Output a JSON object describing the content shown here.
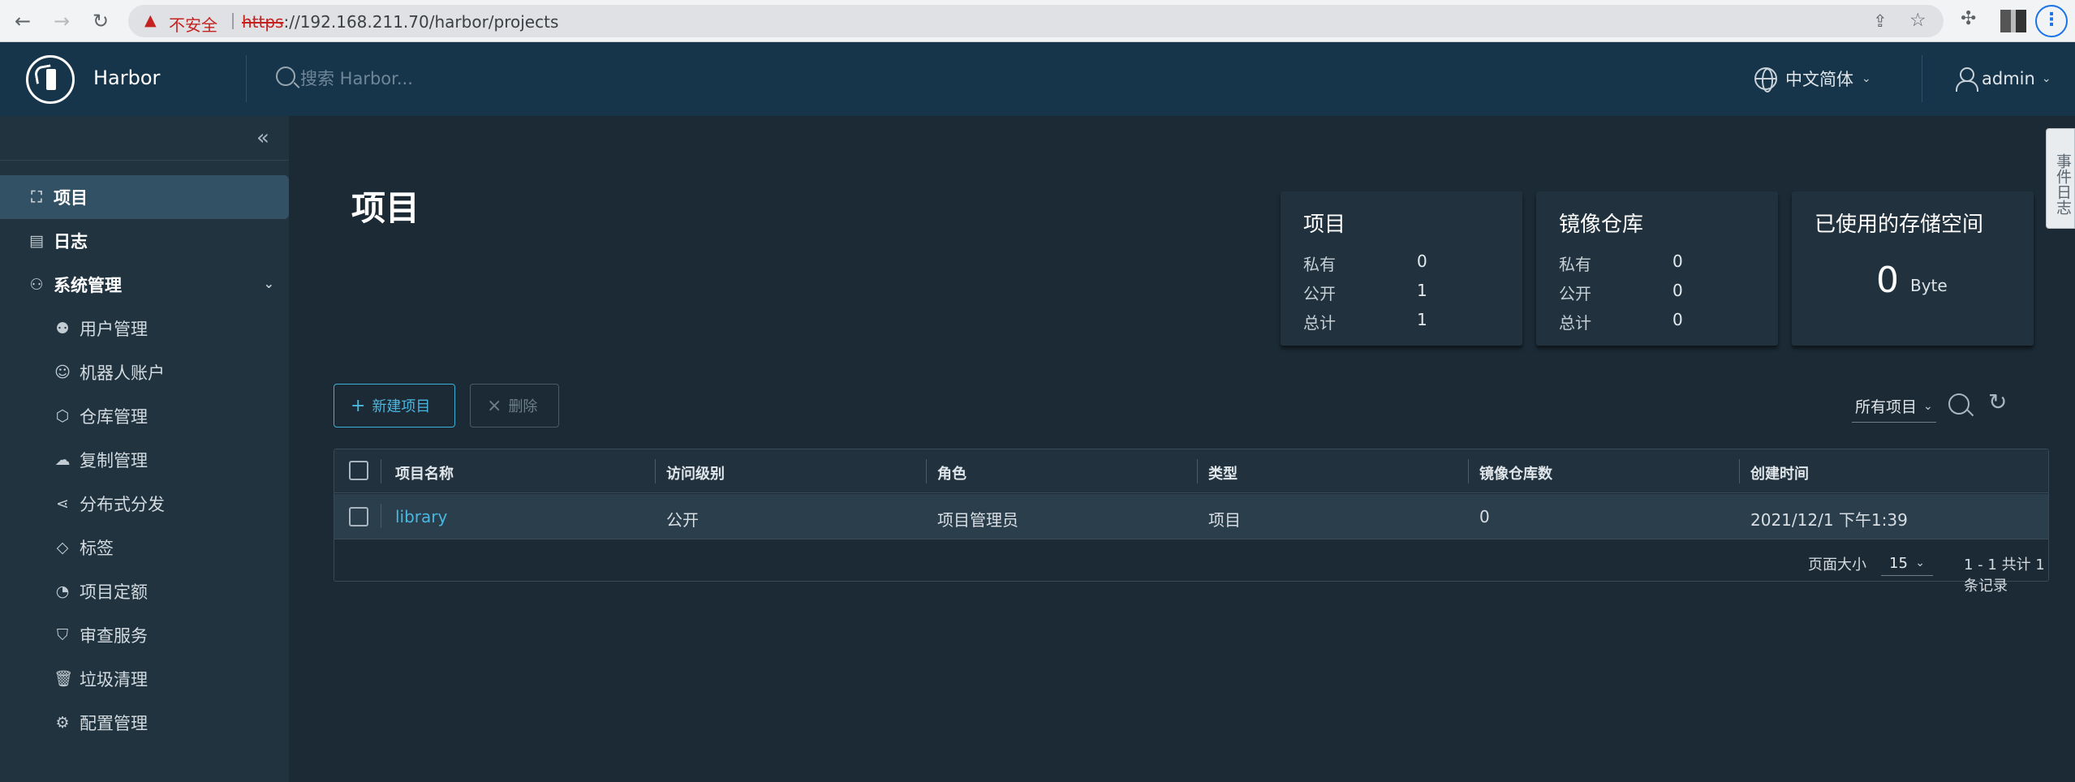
{
  "browser": {
    "security_label": "不安全",
    "url_scheme": "https",
    "url_rest": "://192.168.211.70/harbor/projects"
  },
  "header": {
    "brand": "Harbor",
    "search_placeholder": "搜索 Harbor...",
    "language": "中文简体",
    "user": "admin"
  },
  "sidebar": {
    "items": [
      {
        "label": "项目",
        "icon": "projects-icon",
        "active": true
      },
      {
        "label": "日志",
        "icon": "logs-icon"
      },
      {
        "label": "系统管理",
        "icon": "admin-icon",
        "expanded": true
      }
    ],
    "sub_items": [
      {
        "label": "用户管理",
        "icon": "users-icon"
      },
      {
        "label": "机器人账户",
        "icon": "robot-icon"
      },
      {
        "label": "仓库管理",
        "icon": "registry-icon"
      },
      {
        "label": "复制管理",
        "icon": "replication-icon"
      },
      {
        "label": "分布式分发",
        "icon": "distribution-icon"
      },
      {
        "label": "标签",
        "icon": "tag-icon"
      },
      {
        "label": "项目定额",
        "icon": "quota-icon"
      },
      {
        "label": "审查服务",
        "icon": "shield-icon"
      },
      {
        "label": "垃圾清理",
        "icon": "trash-icon"
      },
      {
        "label": "配置管理",
        "icon": "gear-icon"
      }
    ]
  },
  "main": {
    "title": "项目",
    "cards": {
      "projects": {
        "title": "项目",
        "rows": [
          {
            "label": "私有",
            "value": "0"
          },
          {
            "label": "公开",
            "value": "1"
          },
          {
            "label": "总计",
            "value": "1"
          }
        ]
      },
      "repos": {
        "title": "镜像仓库",
        "rows": [
          {
            "label": "私有",
            "value": "0"
          },
          {
            "label": "公开",
            "value": "0"
          },
          {
            "label": "总计",
            "value": "0"
          }
        ]
      },
      "storage": {
        "title": "已使用的存储空间",
        "value": "0",
        "unit": "Byte"
      }
    },
    "toolbar": {
      "new_project": "新建项目",
      "delete": "删除",
      "filter": "所有项目"
    },
    "table": {
      "columns": [
        "项目名称",
        "访问级别",
        "角色",
        "类型",
        "镜像仓库数",
        "创建时间"
      ],
      "rows": [
        {
          "name": "library",
          "access": "公开",
          "role": "项目管理员",
          "type": "项目",
          "repo_count": "0",
          "created": "2021/12/1 下午1:39"
        }
      ],
      "page_size_label": "页面大小",
      "page_size": "15",
      "page_info": "1 - 1 共计 1 条记录"
    },
    "side_tab": "事件日志"
  }
}
